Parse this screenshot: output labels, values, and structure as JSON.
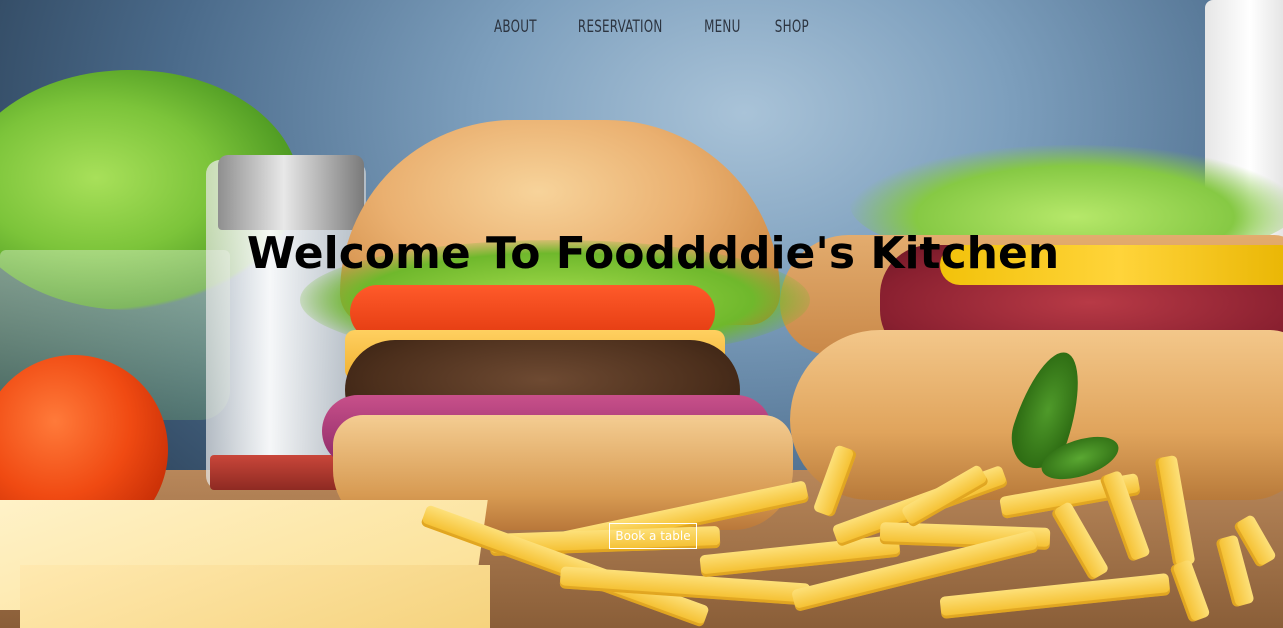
{
  "nav": {
    "items": [
      {
        "label": "ABOUT"
      },
      {
        "label": "RESERVATION"
      },
      {
        "label": "MENU"
      },
      {
        "label": "SHOP"
      }
    ]
  },
  "hero": {
    "title": "Welcome To Fooddddie's Kitchen",
    "cta_label": "Book a table",
    "image_subject": "burger-hotdog-fries-photo"
  },
  "colors": {
    "nav_text": "#2c3440",
    "title_text": "#000000",
    "cta_text": "#ffffff",
    "cta_border": "#ffffff"
  }
}
